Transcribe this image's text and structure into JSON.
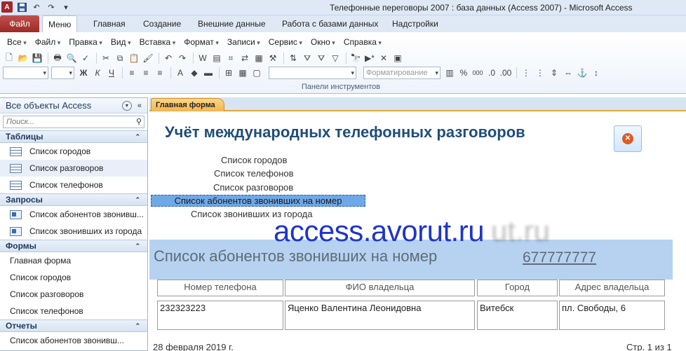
{
  "window": {
    "title": "Телефонные переговоры 2007 : база данных (Access 2007)  -  Microsoft Access"
  },
  "quick_access": {
    "icons": [
      "access-app-icon",
      "save-icon",
      "undo-icon",
      "redo-icon",
      "customize-icon"
    ]
  },
  "ribbon": {
    "file_tab": "Файл",
    "tabs": [
      "Меню",
      "Главная",
      "Создание",
      "Внешние данные",
      "Работа с базами данных",
      "Надстройки"
    ],
    "active_tab": "Меню",
    "menu": [
      "Все",
      "Файл",
      "Правка",
      "Вид",
      "Вставка",
      "Формат",
      "Записи",
      "Сервис",
      "Окно",
      "Справка"
    ],
    "format_combo": "Форматирование",
    "group_label": "Панели инструментов"
  },
  "nav": {
    "header": "Все объекты Access",
    "search_placeholder": "Поиск...",
    "groups": [
      {
        "label": "Таблицы",
        "items": [
          "Список городов",
          "Список разговоров",
          "Список телефонов"
        ]
      },
      {
        "label": "Запросы",
        "items": [
          "Список абонентов звонивш...",
          "Список звонивших из города"
        ]
      },
      {
        "label": "Формы",
        "items": [
          "Главная форма",
          "Список городов",
          "Список разговоров",
          "Список телефонов"
        ]
      },
      {
        "label": "Отчеты",
        "items": [
          "Список абонентов звонивш..."
        ]
      }
    ],
    "selected_item": "Список разговоров"
  },
  "document": {
    "tab_label": "Главная форма"
  },
  "form": {
    "title": "Учёт международных телефонных разговоров",
    "links": [
      "Список городов",
      "Список телефонов",
      "Список разговоров",
      "Список абонентов звонивших на номер",
      "Список звонивших из города"
    ],
    "selected_link": "Список абонентов звонивших на номер"
  },
  "watermark": "access.avorut.ru",
  "watermark_ghost": "ut.ru",
  "report": {
    "title": "Список абонентов звонивших на номер",
    "phone": "677777777",
    "columns": [
      "Номер телефона",
      "ФИО владельца",
      "Город",
      "Адрес владельца"
    ],
    "rows": [
      [
        "232323223",
        "Яценко Валентина Леонидовна",
        "Витебск",
        "пл. Свободы, 6"
      ]
    ],
    "date": "28 февраля 2019 г.",
    "page": "Стр. 1 из 1"
  },
  "colors": {
    "file_tab": "#a4262c",
    "form_title": "#1f4e79",
    "report_header_band": "#b6d2f0",
    "watermark": "#1f35c9",
    "doc_tab": "#f3b451"
  }
}
